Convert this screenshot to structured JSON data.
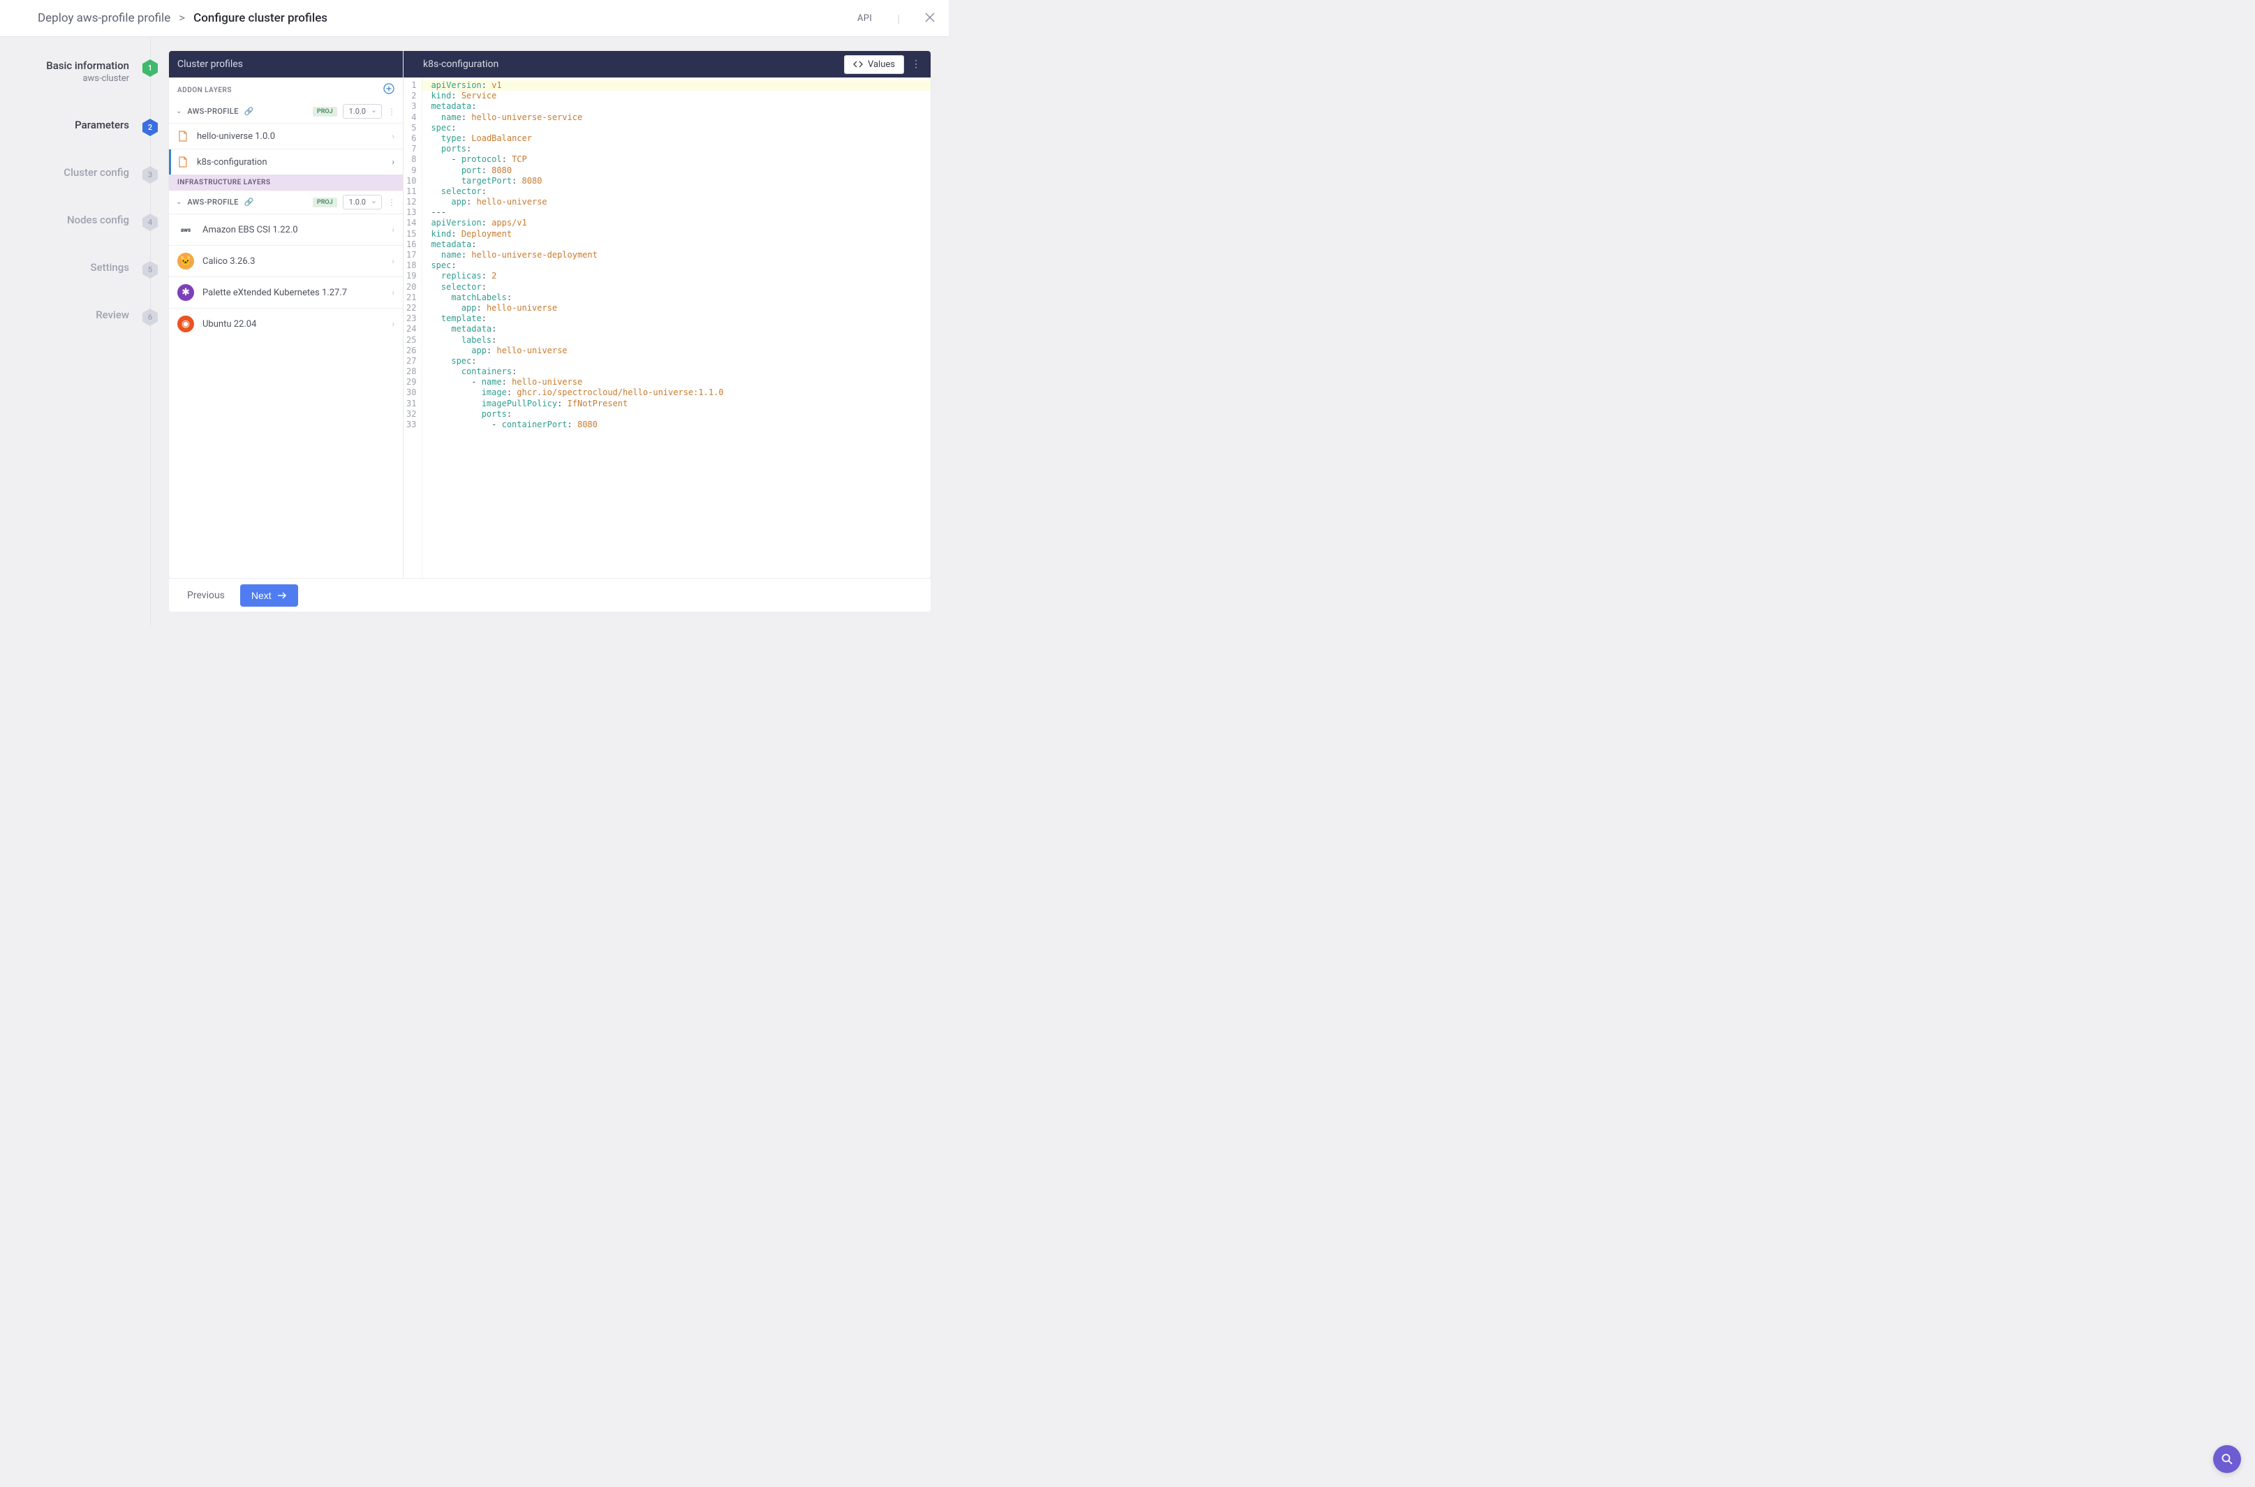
{
  "breadcrumb": {
    "root": "Deploy aws-profile profile",
    "sep": ">",
    "current": "Configure cluster profiles"
  },
  "topbar": {
    "api": "API"
  },
  "steps": [
    {
      "title": "Basic information",
      "sub": "aws-cluster",
      "num": "1",
      "color": "#3fb96c",
      "active": true
    },
    {
      "title": "Parameters",
      "sub": "",
      "num": "2",
      "color": "#3b6fe0",
      "active": true
    },
    {
      "title": "Cluster config",
      "sub": "",
      "num": "3",
      "color": "#d5d7e0",
      "active": false
    },
    {
      "title": "Nodes config",
      "sub": "",
      "num": "4",
      "color": "#d5d7e0",
      "active": false
    },
    {
      "title": "Settings",
      "sub": "",
      "num": "5",
      "color": "#d5d7e0",
      "active": false
    },
    {
      "title": "Review",
      "sub": "",
      "num": "6",
      "color": "#d5d7e0",
      "active": false
    }
  ],
  "leftPanel": {
    "title": "Cluster profiles",
    "addonHeader": "ADDON LAYERS",
    "infraHeader": "INFRASTRUCTURE LAYERS",
    "profile": {
      "name": "AWS-PROFILE",
      "badge": "PROJ",
      "version": "1.0.0"
    },
    "addonLayers": [
      {
        "name": "hello-universe 1.0.0",
        "selected": false
      },
      {
        "name": "k8s-configuration",
        "selected": true
      }
    ],
    "infraProfile": {
      "name": "AWS-PROFILE",
      "badge": "PROJ",
      "version": "1.0.0"
    },
    "infraLayers": [
      {
        "name": "Amazon EBS CSI 1.22.0",
        "iconBg": "#fff",
        "iconTxt": "aws"
      },
      {
        "name": "Calico 3.26.3",
        "iconBg": "#f4a742",
        "iconTxt": "🐱"
      },
      {
        "name": "Palette eXtended Kubernetes 1.27.7",
        "iconBg": "#7c3fb9",
        "iconTxt": "✱"
      },
      {
        "name": "Ubuntu 22.04",
        "iconBg": "#e95420",
        "iconTxt": "◉"
      }
    ]
  },
  "rightPanel": {
    "title": "k8s-configuration",
    "valuesBtn": "Values"
  },
  "code": [
    [
      [
        "k",
        "apiVersion"
      ],
      [
        "p",
        ": "
      ],
      [
        "v",
        "v1"
      ]
    ],
    [
      [
        "k",
        "kind"
      ],
      [
        "p",
        ": "
      ],
      [
        "v",
        "Service"
      ]
    ],
    [
      [
        "k",
        "metadata"
      ],
      [
        "p",
        ":"
      ]
    ],
    [
      [
        "p",
        "  "
      ],
      [
        "k",
        "name"
      ],
      [
        "p",
        ": "
      ],
      [
        "v",
        "hello-universe-service"
      ]
    ],
    [
      [
        "k",
        "spec"
      ],
      [
        "p",
        ":"
      ]
    ],
    [
      [
        "p",
        "  "
      ],
      [
        "k",
        "type"
      ],
      [
        "p",
        ": "
      ],
      [
        "v",
        "LoadBalancer"
      ]
    ],
    [
      [
        "p",
        "  "
      ],
      [
        "k",
        "ports"
      ],
      [
        "p",
        ":"
      ]
    ],
    [
      [
        "p",
        "    - "
      ],
      [
        "k",
        "protocol"
      ],
      [
        "p",
        ": "
      ],
      [
        "v",
        "TCP"
      ]
    ],
    [
      [
        "p",
        "      "
      ],
      [
        "k",
        "port"
      ],
      [
        "p",
        ": "
      ],
      [
        "v",
        "8080"
      ]
    ],
    [
      [
        "p",
        "      "
      ],
      [
        "k",
        "targetPort"
      ],
      [
        "p",
        ": "
      ],
      [
        "v",
        "8080"
      ]
    ],
    [
      [
        "p",
        "  "
      ],
      [
        "k",
        "selector"
      ],
      [
        "p",
        ":"
      ]
    ],
    [
      [
        "p",
        "    "
      ],
      [
        "k",
        "app"
      ],
      [
        "p",
        ": "
      ],
      [
        "v",
        "hello-universe"
      ]
    ],
    [
      [
        "p",
        "---"
      ]
    ],
    [
      [
        "k",
        "apiVersion"
      ],
      [
        "p",
        ": "
      ],
      [
        "v",
        "apps/v1"
      ]
    ],
    [
      [
        "k",
        "kind"
      ],
      [
        "p",
        ": "
      ],
      [
        "v",
        "Deployment"
      ]
    ],
    [
      [
        "k",
        "metadata"
      ],
      [
        "p",
        ":"
      ]
    ],
    [
      [
        "p",
        "  "
      ],
      [
        "k",
        "name"
      ],
      [
        "p",
        ": "
      ],
      [
        "v",
        "hello-universe-deployment"
      ]
    ],
    [
      [
        "k",
        "spec"
      ],
      [
        "p",
        ":"
      ]
    ],
    [
      [
        "p",
        "  "
      ],
      [
        "k",
        "replicas"
      ],
      [
        "p",
        ": "
      ],
      [
        "v",
        "2"
      ]
    ],
    [
      [
        "p",
        "  "
      ],
      [
        "k",
        "selector"
      ],
      [
        "p",
        ":"
      ]
    ],
    [
      [
        "p",
        "    "
      ],
      [
        "k",
        "matchLabels"
      ],
      [
        "p",
        ":"
      ]
    ],
    [
      [
        "p",
        "      "
      ],
      [
        "k",
        "app"
      ],
      [
        "p",
        ": "
      ],
      [
        "v",
        "hello-universe"
      ]
    ],
    [
      [
        "p",
        "  "
      ],
      [
        "k",
        "template"
      ],
      [
        "p",
        ":"
      ]
    ],
    [
      [
        "p",
        "    "
      ],
      [
        "k",
        "metadata"
      ],
      [
        "p",
        ":"
      ]
    ],
    [
      [
        "p",
        "      "
      ],
      [
        "k",
        "labels"
      ],
      [
        "p",
        ":"
      ]
    ],
    [
      [
        "p",
        "        "
      ],
      [
        "k",
        "app"
      ],
      [
        "p",
        ": "
      ],
      [
        "v",
        "hello-universe"
      ]
    ],
    [
      [
        "p",
        "    "
      ],
      [
        "k",
        "spec"
      ],
      [
        "p",
        ":"
      ]
    ],
    [
      [
        "p",
        "      "
      ],
      [
        "k",
        "containers"
      ],
      [
        "p",
        ":"
      ]
    ],
    [
      [
        "p",
        "        - "
      ],
      [
        "k",
        "name"
      ],
      [
        "p",
        ": "
      ],
      [
        "v",
        "hello-universe"
      ]
    ],
    [
      [
        "p",
        "          "
      ],
      [
        "k",
        "image"
      ],
      [
        "p",
        ": "
      ],
      [
        "v",
        "ghcr.io/spectrocloud/hello-universe:1.1.0"
      ]
    ],
    [
      [
        "p",
        "          "
      ],
      [
        "k",
        "imagePullPolicy"
      ],
      [
        "p",
        ": "
      ],
      [
        "v",
        "IfNotPresent"
      ]
    ],
    [
      [
        "p",
        "          "
      ],
      [
        "k",
        "ports"
      ],
      [
        "p",
        ":"
      ]
    ],
    [
      [
        "p",
        "            - "
      ],
      [
        "k",
        "containerPort"
      ],
      [
        "p",
        ": "
      ],
      [
        "v",
        "8080"
      ]
    ]
  ],
  "footer": {
    "prev": "Previous",
    "next": "Next"
  }
}
